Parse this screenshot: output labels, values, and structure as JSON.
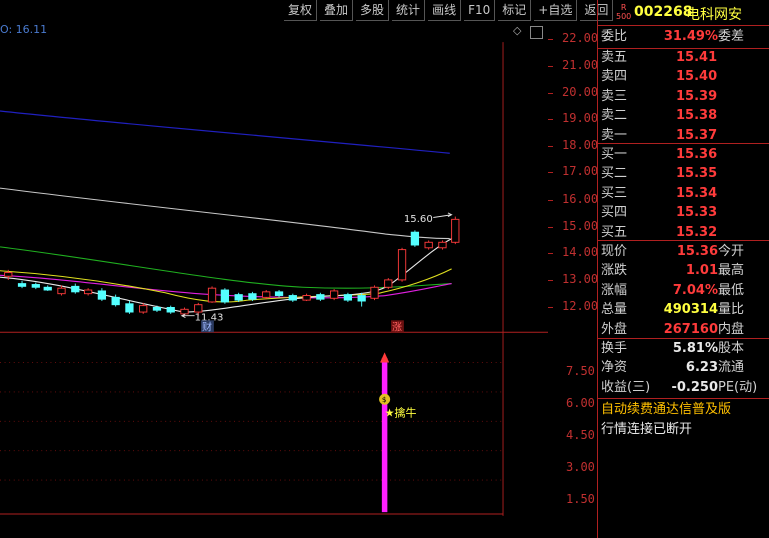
{
  "toolbar": {
    "buttons": [
      "复权",
      "叠加",
      "多股",
      "统计",
      "画线",
      "F10",
      "标记",
      "+自选",
      "返回"
    ]
  },
  "chart": {
    "time_label": "O: 16.11",
    "price_ticks": [
      "22.00",
      "21.00",
      "20.00",
      "19.00",
      "18.00",
      "17.00",
      "16.00",
      "15.00",
      "14.00",
      "13.00",
      "12.00"
    ],
    "high_label": "15.60",
    "low_label": "11.43",
    "cai_marker": "财",
    "zhang_marker": "涨",
    "indicator_ticks": [
      "7.50",
      "6.00",
      "4.50",
      "3.00",
      "1.50"
    ],
    "signal_label": "★擒牛",
    "colors": {
      "up_candle": "#ff3b3b",
      "down_candle": "#54ffff",
      "ma_blue": "#2020c0",
      "ma_white": "#d0d0d0",
      "ma_green": "#20b020",
      "ma_magenta": "#e020e0",
      "ma_yellow": "#e0e020",
      "grid_red": "#b02020",
      "indicator_bar": "#ff20ff"
    }
  },
  "quote": {
    "badge_top": "R",
    "badge_bottom": "500",
    "code": "002268",
    "name": "电科网安",
    "weibi_label": "委比",
    "weibi_value": "31.49%",
    "weicha_label": "委差",
    "sell": [
      {
        "label": "卖五",
        "price": "15.41"
      },
      {
        "label": "卖四",
        "price": "15.40"
      },
      {
        "label": "卖三",
        "price": "15.39"
      },
      {
        "label": "卖二",
        "price": "15.38"
      },
      {
        "label": "卖一",
        "price": "15.37"
      }
    ],
    "buy": [
      {
        "label": "买一",
        "price": "15.36"
      },
      {
        "label": "买二",
        "price": "15.35"
      },
      {
        "label": "买三",
        "price": "15.34"
      },
      {
        "label": "买四",
        "price": "15.33"
      },
      {
        "label": "买五",
        "price": "15.32"
      }
    ],
    "stats": [
      {
        "label": "现价",
        "value": "15.36",
        "label2": "今开",
        "color": "#ff3b3b"
      },
      {
        "label": "涨跌",
        "value": "1.01",
        "label2": "最高",
        "color": "#ff3b3b"
      },
      {
        "label": "涨幅",
        "value": "7.04%",
        "label2": "最低",
        "color": "#ff3b3b"
      },
      {
        "label": "总量",
        "value": "490314",
        "label2": "量比",
        "color": "#ffff40"
      },
      {
        "label": "外盘",
        "value": "267160",
        "label2": "内盘",
        "color": "#ff3b3b"
      }
    ],
    "stats2": [
      {
        "label": "换手",
        "value": "5.81%",
        "label2": "股本",
        "color": "#e8e8e8"
      },
      {
        "label": "净资",
        "value": "6.23",
        "label2": "流通",
        "color": "#e8e8e8"
      },
      {
        "label": "收益(三)",
        "value": "-0.250",
        "label2": "PE(动)",
        "color": "#e8e8e8"
      }
    ],
    "promo": "自动续费通达信普及版",
    "status": "行情连接已断开"
  }
}
